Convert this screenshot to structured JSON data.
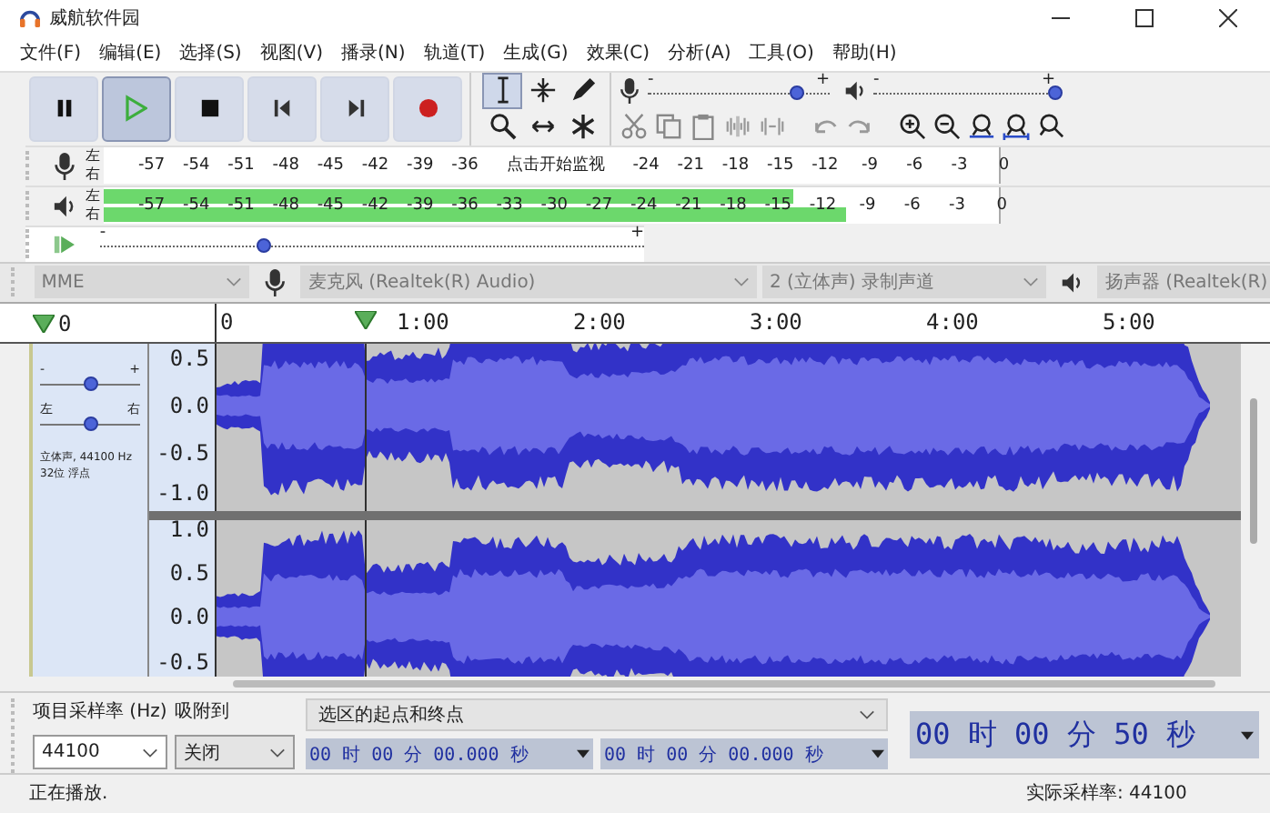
{
  "window": {
    "title": "威航软件园"
  },
  "menu": [
    "文件(F)",
    "编辑(E)",
    "选择(S)",
    "视图(V)",
    "播录(N)",
    "轨道(T)",
    "生成(G)",
    "效果(C)",
    "分析(A)",
    "工具(O)",
    "帮助(H)"
  ],
  "transport": [
    {
      "kind": "pause",
      "pressed": false
    },
    {
      "kind": "play",
      "pressed": true
    },
    {
      "kind": "stop",
      "pressed": false
    },
    {
      "kind": "skip-start",
      "pressed": false
    },
    {
      "kind": "skip-end",
      "pressed": false
    },
    {
      "kind": "record",
      "pressed": false
    }
  ],
  "tools": [
    {
      "kind": "select",
      "selected": true
    },
    {
      "kind": "envelope",
      "selected": false
    },
    {
      "kind": "draw",
      "selected": false
    },
    {
      "kind": "zoom",
      "selected": false
    },
    {
      "kind": "time-shift",
      "selected": false
    },
    {
      "kind": "multi",
      "selected": false
    }
  ],
  "recording_volume": {
    "min_label": "-",
    "max_label": "+",
    "level": 0.82
  },
  "playback_volume": {
    "min_label": "-",
    "max_label": "+",
    "level": 1.0
  },
  "recording_meter": {
    "channels": [
      "左",
      "右"
    ],
    "ticks_before": [
      "-57",
      "-54",
      "-51",
      "-48",
      "-45",
      "-42",
      "-39",
      "-36"
    ],
    "hint": "点击开始监视",
    "ticks_after": [
      "-24",
      "-21",
      "-18",
      "-15",
      "-12",
      "-9",
      "-6",
      "-3",
      "0"
    ]
  },
  "playback_meter": {
    "channels": [
      {
        "label": "左",
        "level": 0.77
      },
      {
        "label": "右",
        "level": 0.83
      }
    ],
    "ticks": [
      "-57",
      "-54",
      "-51",
      "-48",
      "-45",
      "-42",
      "-39",
      "-36",
      "-33",
      "-30",
      "-27",
      "-24",
      "-21",
      "-18",
      "-15",
      "-12",
      "-9",
      "-6",
      "-3",
      "0"
    ]
  },
  "play_at_speed": {
    "min_label": "-",
    "max_label": "+",
    "level": 0.3
  },
  "device_bar": {
    "host": "MME",
    "input_device": "麦克风 (Realtek(R) Audio)",
    "channels": "2 (立体声) 录制声道",
    "output_device": "扬声器 (Realtek(R)"
  },
  "ruler": {
    "start_label": "0",
    "labels": [
      "0",
      "1:00",
      "2:00",
      "3:00",
      "4:00",
      "5:00"
    ]
  },
  "track": {
    "gain": {
      "min_label": "-",
      "max_label": "+",
      "level": 0.5
    },
    "pan": {
      "min_label": "左",
      "max_label": "右",
      "level": 0.5
    },
    "info": [
      "立体声, 44100 Hz",
      "32位 浮点"
    ],
    "channels": [
      {
        "scale": [
          "0.5",
          "0.0",
          "-0.5",
          "-1.0"
        ]
      },
      {
        "scale": [
          "1.0",
          "0.5",
          "0.0",
          "-0.5"
        ]
      }
    ]
  },
  "selection_bar": {
    "rate_label": "项目采样率 (Hz)",
    "rate": "44100",
    "snap_label": "吸附到",
    "snap": "关闭",
    "mode": "选区的起点和终点",
    "start": "00 时 00 分 00.000 秒",
    "end": "00 时 00 分 00.000 秒",
    "position": "00 时 00 分 50 秒"
  },
  "status_bar": {
    "state": "正在播放.",
    "rate": "实际采样率: 44100"
  }
}
